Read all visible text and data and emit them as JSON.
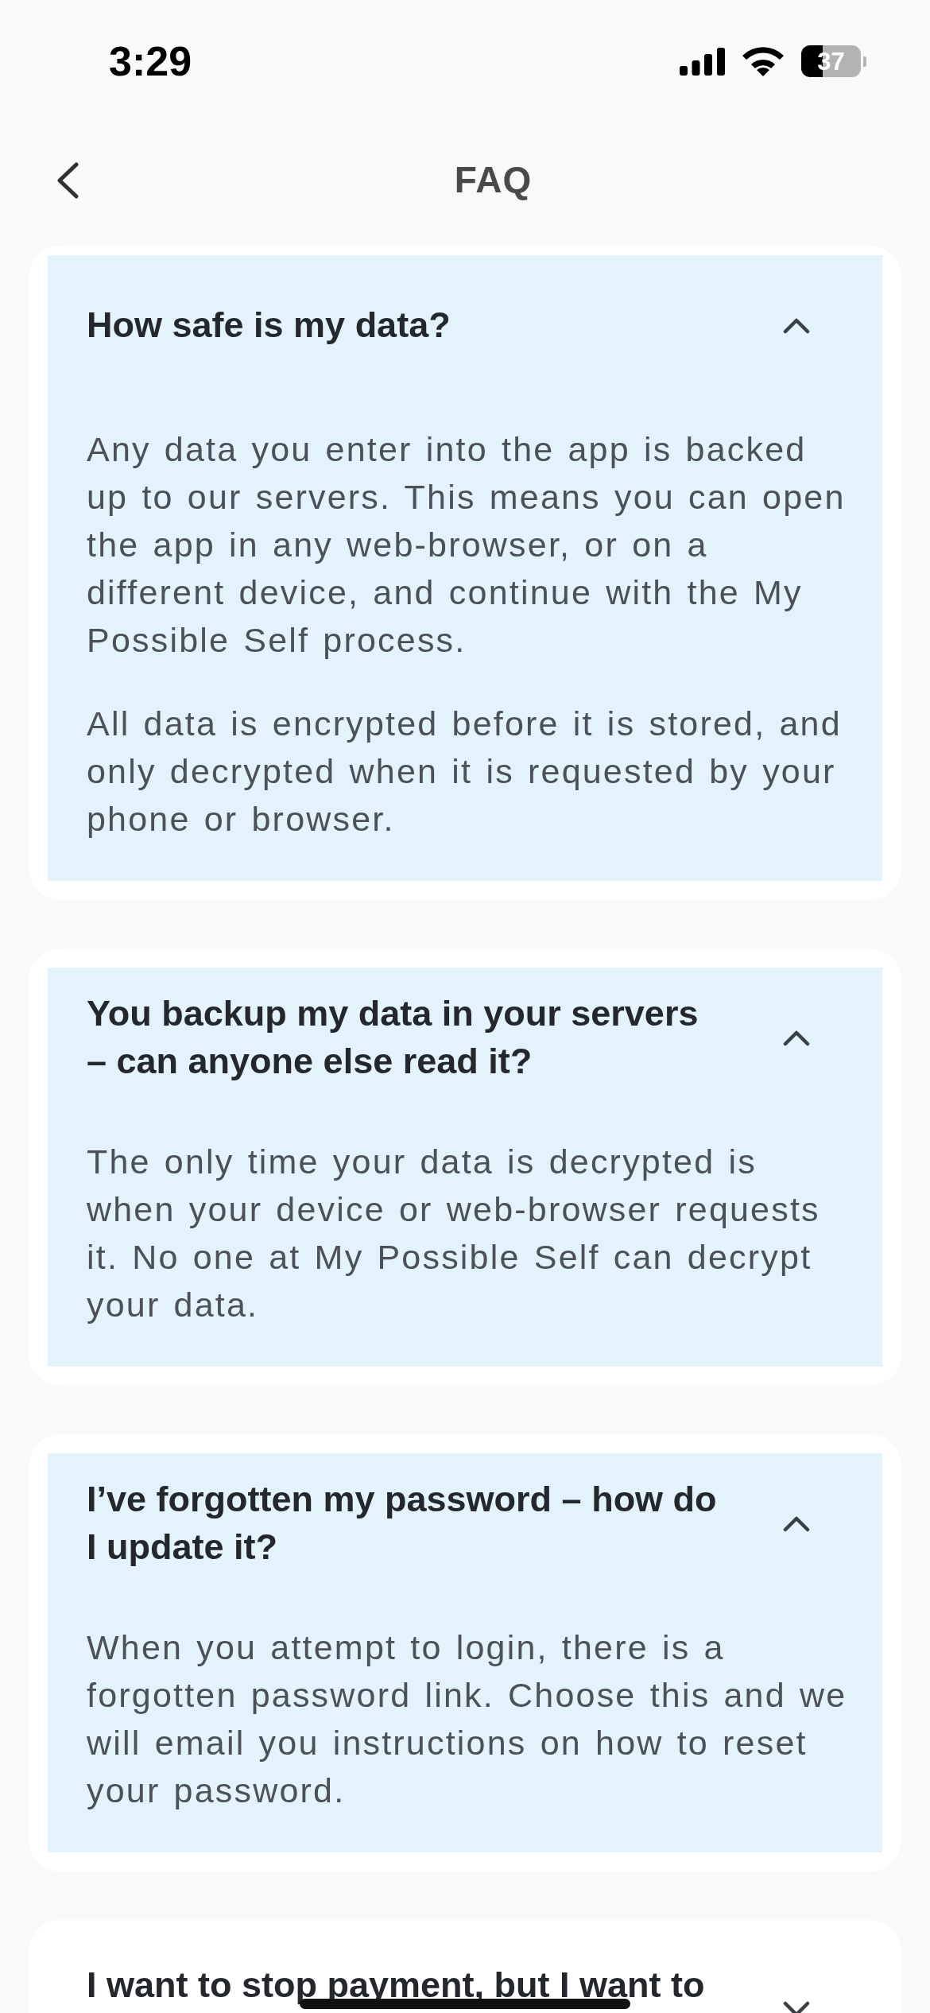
{
  "status_bar": {
    "time": "3:29",
    "battery": "37"
  },
  "nav": {
    "title": "FAQ"
  },
  "faqs": [
    {
      "question": "How safe is my data?",
      "expanded": true,
      "answer": [
        "Any data you enter into the app is backed up to our servers. This means you can open the app in any web-browser, or on a different device, and continue with the My Possible Self process.",
        "All data is encrypted before it is stored, and only decrypted when it is requested by your phone or browser."
      ]
    },
    {
      "question": "You backup my data in your servers – can anyone else read it?",
      "expanded": true,
      "answer": [
        "The only time your data is decrypted is when your device or web-browser requests it. No one at My Possible Self can decrypt your data."
      ]
    },
    {
      "question": "I’ve forgotten my password – how do I update it?",
      "expanded": true,
      "answer": [
        "When you attempt to login, there is a forgotten password link. Choose this and we will email you instructions on how to reset your password."
      ]
    },
    {
      "question": "I want to stop payment, but I want to",
      "expanded": false
    }
  ]
}
